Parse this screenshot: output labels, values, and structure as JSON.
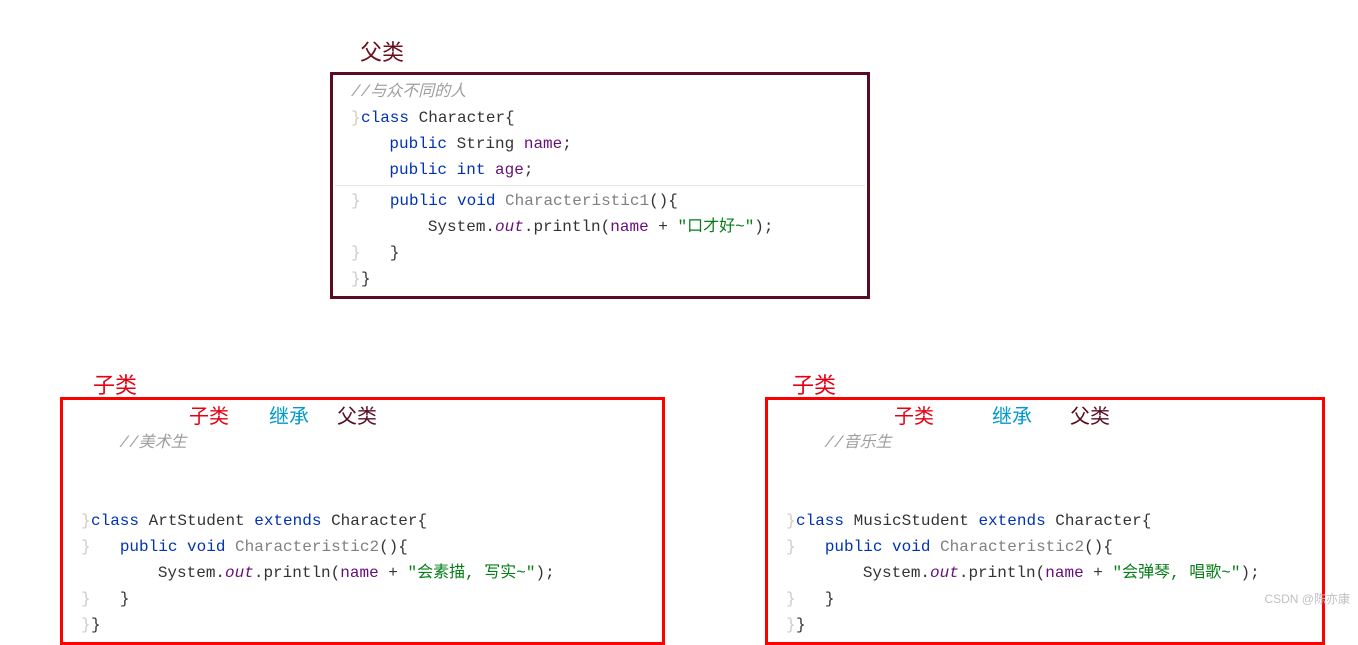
{
  "labels": {
    "parent_top": "父类",
    "sub_left": "子类",
    "sub_right": "子类"
  },
  "ann": {
    "sub": "子类",
    "ext": "继承",
    "par": "父类"
  },
  "parent_box": {
    "comment_head": "//与众不同的人",
    "l2_class": "class",
    "l2_name": "Character{",
    "l3_pub": "public",
    "l3_type": "String",
    "l3_field": "name",
    "l3_semi": ";",
    "l4_pub": "public",
    "l4_type": "int",
    "l4_field": "age",
    "l4_semi": ";",
    "l5_pub": "public",
    "l5_void": "void",
    "l5_meth": "Characteristic1",
    "l5_paren": "(){",
    "l6_sys": "System.",
    "l6_out": "out",
    "l6_print": ".println(",
    "l6_name": "name",
    "l6_plus": " + ",
    "l6_str": "\"口才好~\"",
    "l6_end": ");",
    "l7_close": "}",
    "l8_close": "}"
  },
  "left_box": {
    "comment_head": "//美术生",
    "l2_class": "class",
    "l2_name": "ArtStudent",
    "l2_ext": "extends",
    "l2_par": "Character{",
    "l3_pub": "public",
    "l3_void": "void",
    "l3_meth": "Characteristic2",
    "l3_paren": "(){",
    "l4_sys": "System.",
    "l4_out": "out",
    "l4_print": ".println(",
    "l4_name": "name",
    "l4_plus": " + ",
    "l4_str": "\"会素描, 写实~\"",
    "l4_end": ");",
    "l5_close": "}",
    "l6_close": "}"
  },
  "right_box": {
    "comment_head": "//音乐生",
    "l2_class": "class",
    "l2_name": "MusicStudent",
    "l2_ext": "extends",
    "l2_par": "Character{",
    "blank": "",
    "l3_pub": "public",
    "l3_void": "void",
    "l3_meth": "Characteristic2",
    "l3_paren": "(){",
    "l4_sys": "System.",
    "l4_out": "out",
    "l4_print": ".println(",
    "l4_name": "name",
    "l4_plus": " + ",
    "l4_str": "\"会弹琴, 唱歌~\"",
    "l4_end": ");",
    "l5_close": "}",
    "l6_close": "}"
  },
  "watermark": "CSDN @陈亦康"
}
